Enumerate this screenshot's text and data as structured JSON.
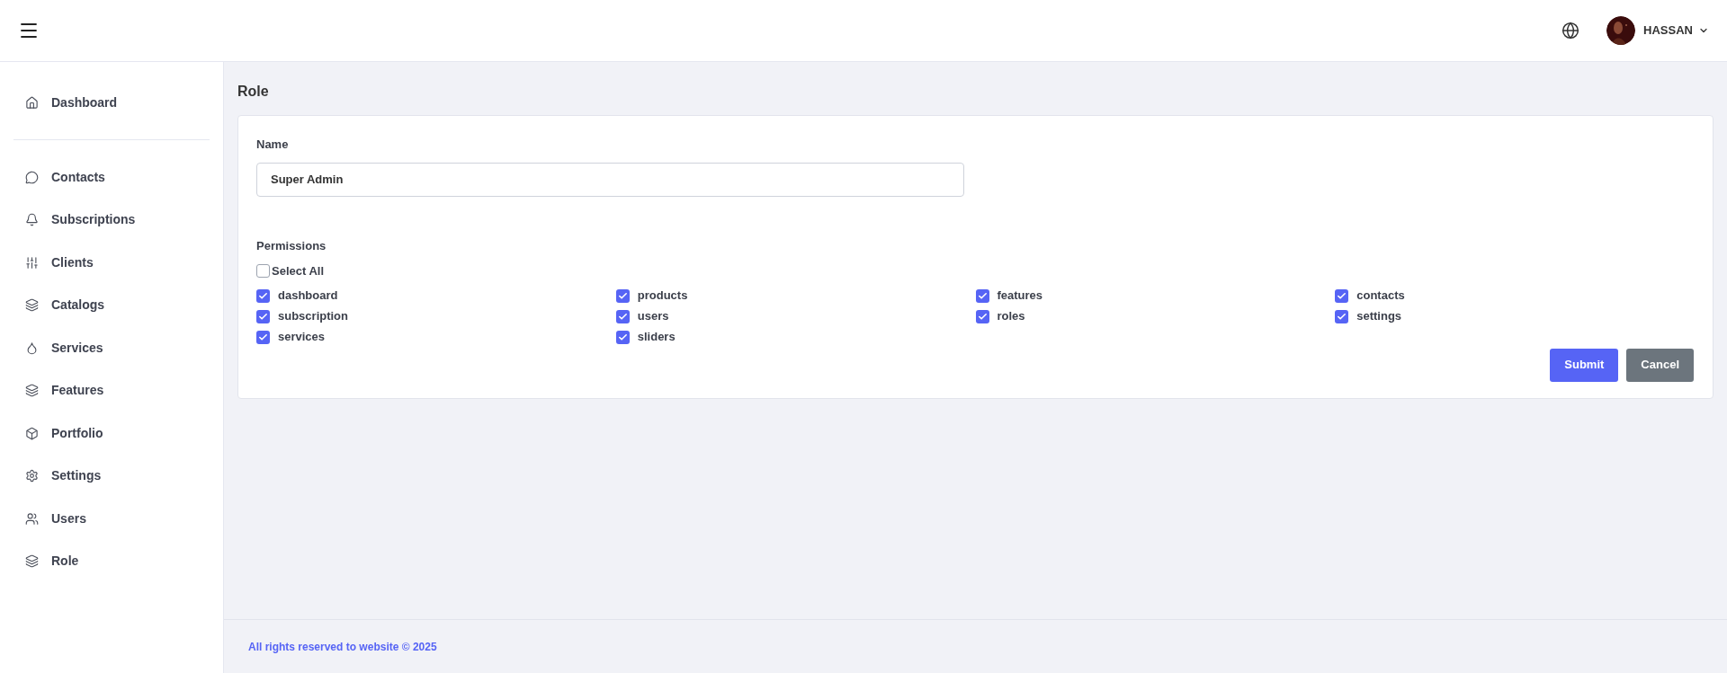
{
  "header": {
    "user": {
      "name": "HASSAN"
    }
  },
  "sidebar": {
    "items": [
      {
        "label": "Dashboard"
      },
      {
        "label": "Contacts"
      },
      {
        "label": "Subscriptions"
      },
      {
        "label": "Clients"
      },
      {
        "label": "Catalogs"
      },
      {
        "label": "Services"
      },
      {
        "label": "Features"
      },
      {
        "label": "Portfolio"
      },
      {
        "label": "Settings"
      },
      {
        "label": "Users"
      },
      {
        "label": "Role"
      }
    ]
  },
  "page": {
    "title": "Role"
  },
  "form": {
    "name_label": "Name",
    "name_value": "Super Admin",
    "permissions_label": "Permissions",
    "select_all": {
      "label": "Select All",
      "checked": false
    },
    "permissions": [
      {
        "label": "dashboard",
        "checked": true
      },
      {
        "label": "products",
        "checked": true
      },
      {
        "label": "features",
        "checked": true
      },
      {
        "label": "contacts",
        "checked": true
      },
      {
        "label": "subscription",
        "checked": true
      },
      {
        "label": "users",
        "checked": true
      },
      {
        "label": "roles",
        "checked": true
      },
      {
        "label": "settings",
        "checked": true
      },
      {
        "label": "services",
        "checked": true
      },
      {
        "label": "sliders",
        "checked": true
      }
    ],
    "buttons": [
      {
        "label": "Submit",
        "kind": "primary"
      },
      {
        "label": "Cancel",
        "kind": "secondary"
      }
    ]
  },
  "footer": {
    "text": "All rights reserved to website © 2025"
  }
}
